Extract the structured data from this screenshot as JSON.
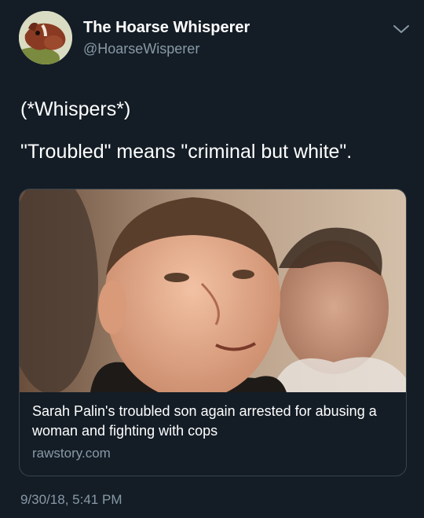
{
  "author": {
    "display_name": "The Hoarse Whisperer",
    "handle": "@HoarseWisperer",
    "avatar_icon": "horse-avatar-icon"
  },
  "tweet": {
    "lines": [
      "(*Whispers*)",
      "\"Troubled\" means \"criminal but white\"."
    ],
    "timestamp": "9/30/18, 5:41 PM"
  },
  "link_card": {
    "title": "Sarah Palin's troubled son again arrested for abusing a woman and fighting with cops",
    "domain": "rawstory.com"
  },
  "icons": {
    "menu": "chevron-down-icon"
  },
  "colors": {
    "background": "#141d26",
    "secondary_text": "#8899a6",
    "card_border": "#38444d"
  }
}
